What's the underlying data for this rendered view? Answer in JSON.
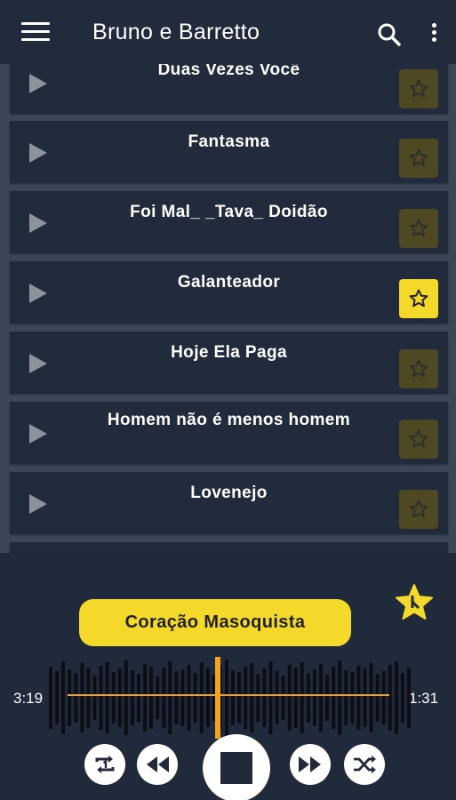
{
  "app_bar": {
    "title": "Bruno e Barretto",
    "menu_icon": "hamburger-menu-icon",
    "search_icon": "search-icon",
    "more_icon": "more-vert-icon"
  },
  "songs": [
    {
      "title": "Duas Vezes Você",
      "favorite": false
    },
    {
      "title": "Fantasma",
      "favorite": false
    },
    {
      "title": "Foi Mal_ _Tava_ Doidão",
      "favorite": false
    },
    {
      "title": "Galanteador",
      "favorite": true
    },
    {
      "title": "Hoje Ela Paga",
      "favorite": false
    },
    {
      "title": "Homem não é menos homem",
      "favorite": false
    },
    {
      "title": "Lovenejo",
      "favorite": false
    }
  ],
  "player": {
    "now_playing": "Coração Masoquista",
    "elapsed": "3:19",
    "remaining": "1:31",
    "favorite": true
  },
  "colors": {
    "accent": "#f4d82a",
    "background": "#3b4757",
    "card": "#212b3b",
    "progress": "#f5a21e"
  }
}
